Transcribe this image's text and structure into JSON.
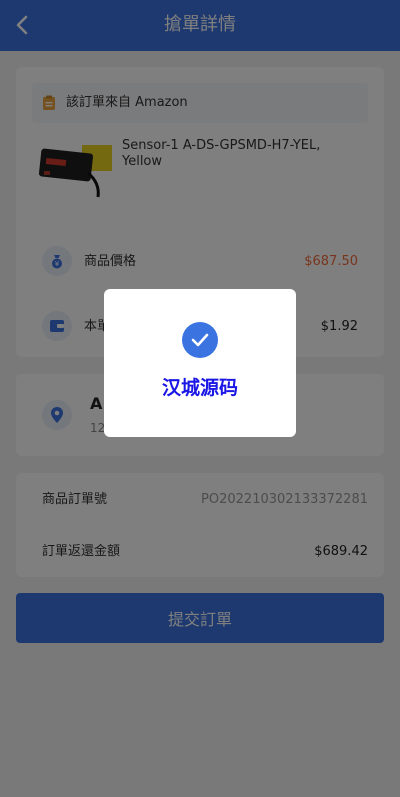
{
  "header": {
    "title": "搶單詳情"
  },
  "product": {
    "source_text": "該訂單來自 Amazon",
    "name": "Sensor-1 A-DS-GPSMD-H7-YEL, Yellow",
    "price_label": "商品價格",
    "price_value": "$687.50",
    "commission_label": "本單",
    "commission_value": "$1.92"
  },
  "address": {
    "name_partial": "A",
    "sub_partial": "12"
  },
  "order": {
    "number_label": "商品訂單號",
    "number_value": "PO202210302133372281",
    "refund_label": "訂單返還金額",
    "refund_value": "$689.42"
  },
  "submit_label": "提交訂單",
  "toast": {
    "message": "汉城源码"
  },
  "colors": {
    "primary": "#3b73e0",
    "price": "#f06a3a",
    "toast_text": "#1a16e6",
    "source_icon": "#e8a33c"
  }
}
